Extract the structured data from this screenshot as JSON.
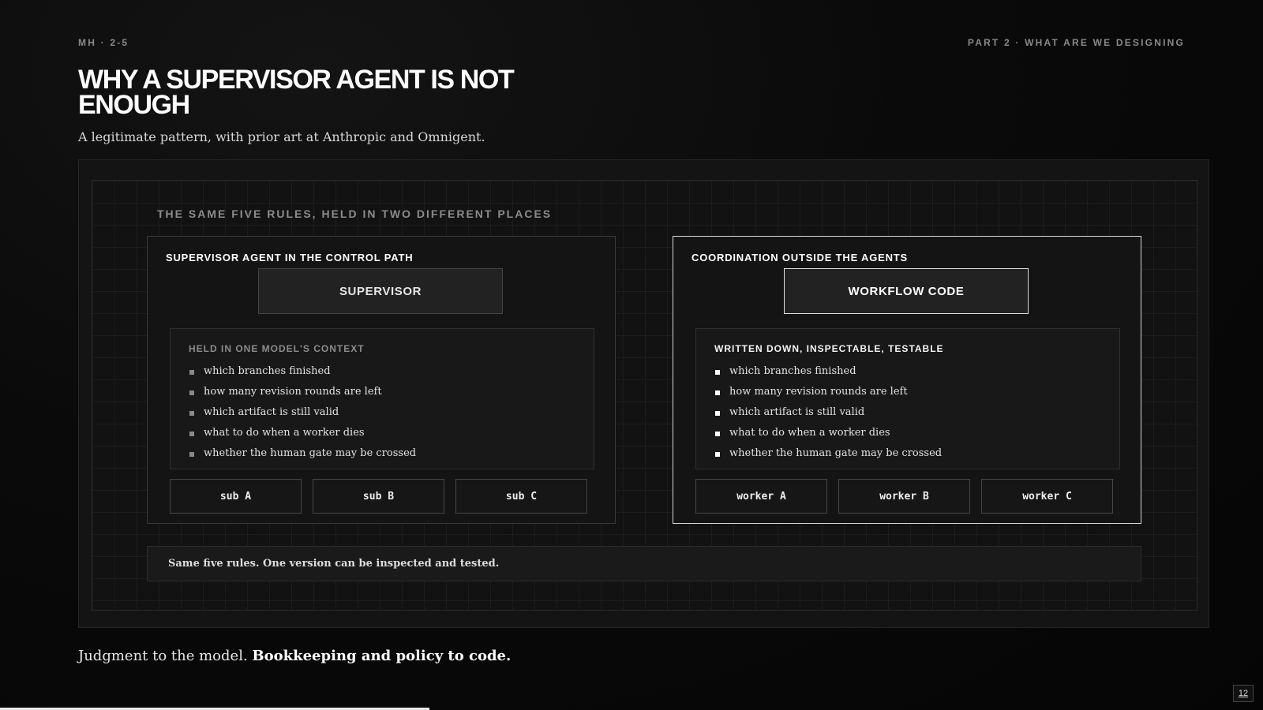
{
  "header": {
    "deck_id": "MH · 2-5",
    "section": "PART 2 · WHAT ARE WE DESIGNING"
  },
  "slide": {
    "title": "WHY A SUPERVISOR AGENT IS NOT ENOUGH",
    "subtitle": "A legitimate pattern, with prior art at Anthropic and Omnigent."
  },
  "diagram": {
    "heading": "THE SAME FIVE RULES, HELD IN TWO DIFFERENT PLACES",
    "left": {
      "title": "SUPERVISOR AGENT IN THE CONTROL PATH",
      "top_box": "SUPERVISOR",
      "rules_label": "HELD IN ONE MODEL'S CONTEXT",
      "rules": [
        "which branches finished",
        "how many revision rounds are left",
        "which artifact is still valid",
        "what to do when a worker dies",
        "whether the human gate may be crossed"
      ],
      "subs": [
        "sub A",
        "sub B",
        "sub C"
      ]
    },
    "right": {
      "title": "COORDINATION OUTSIDE THE AGENTS",
      "top_box": "WORKFLOW CODE",
      "rules_label": "WRITTEN DOWN, INSPECTABLE, TESTABLE",
      "rules": [
        "which branches finished",
        "how many revision rounds are left",
        "which artifact is still valid",
        "what to do when a worker dies",
        "whether the human gate may be crossed"
      ],
      "subs": [
        "worker A",
        "worker B",
        "worker C"
      ]
    },
    "footer_note": "Same five rules. One version can be inspected and tested."
  },
  "takeaway": {
    "normal": "Judgment to the model.",
    "bold": "Bookkeeping and policy to code."
  },
  "footer": {
    "page_number": "12",
    "progress": 0.34
  },
  "colors": {
    "background": "#0a0a0a",
    "accent": "#ffffff",
    "muted": "#8a8a8a"
  }
}
